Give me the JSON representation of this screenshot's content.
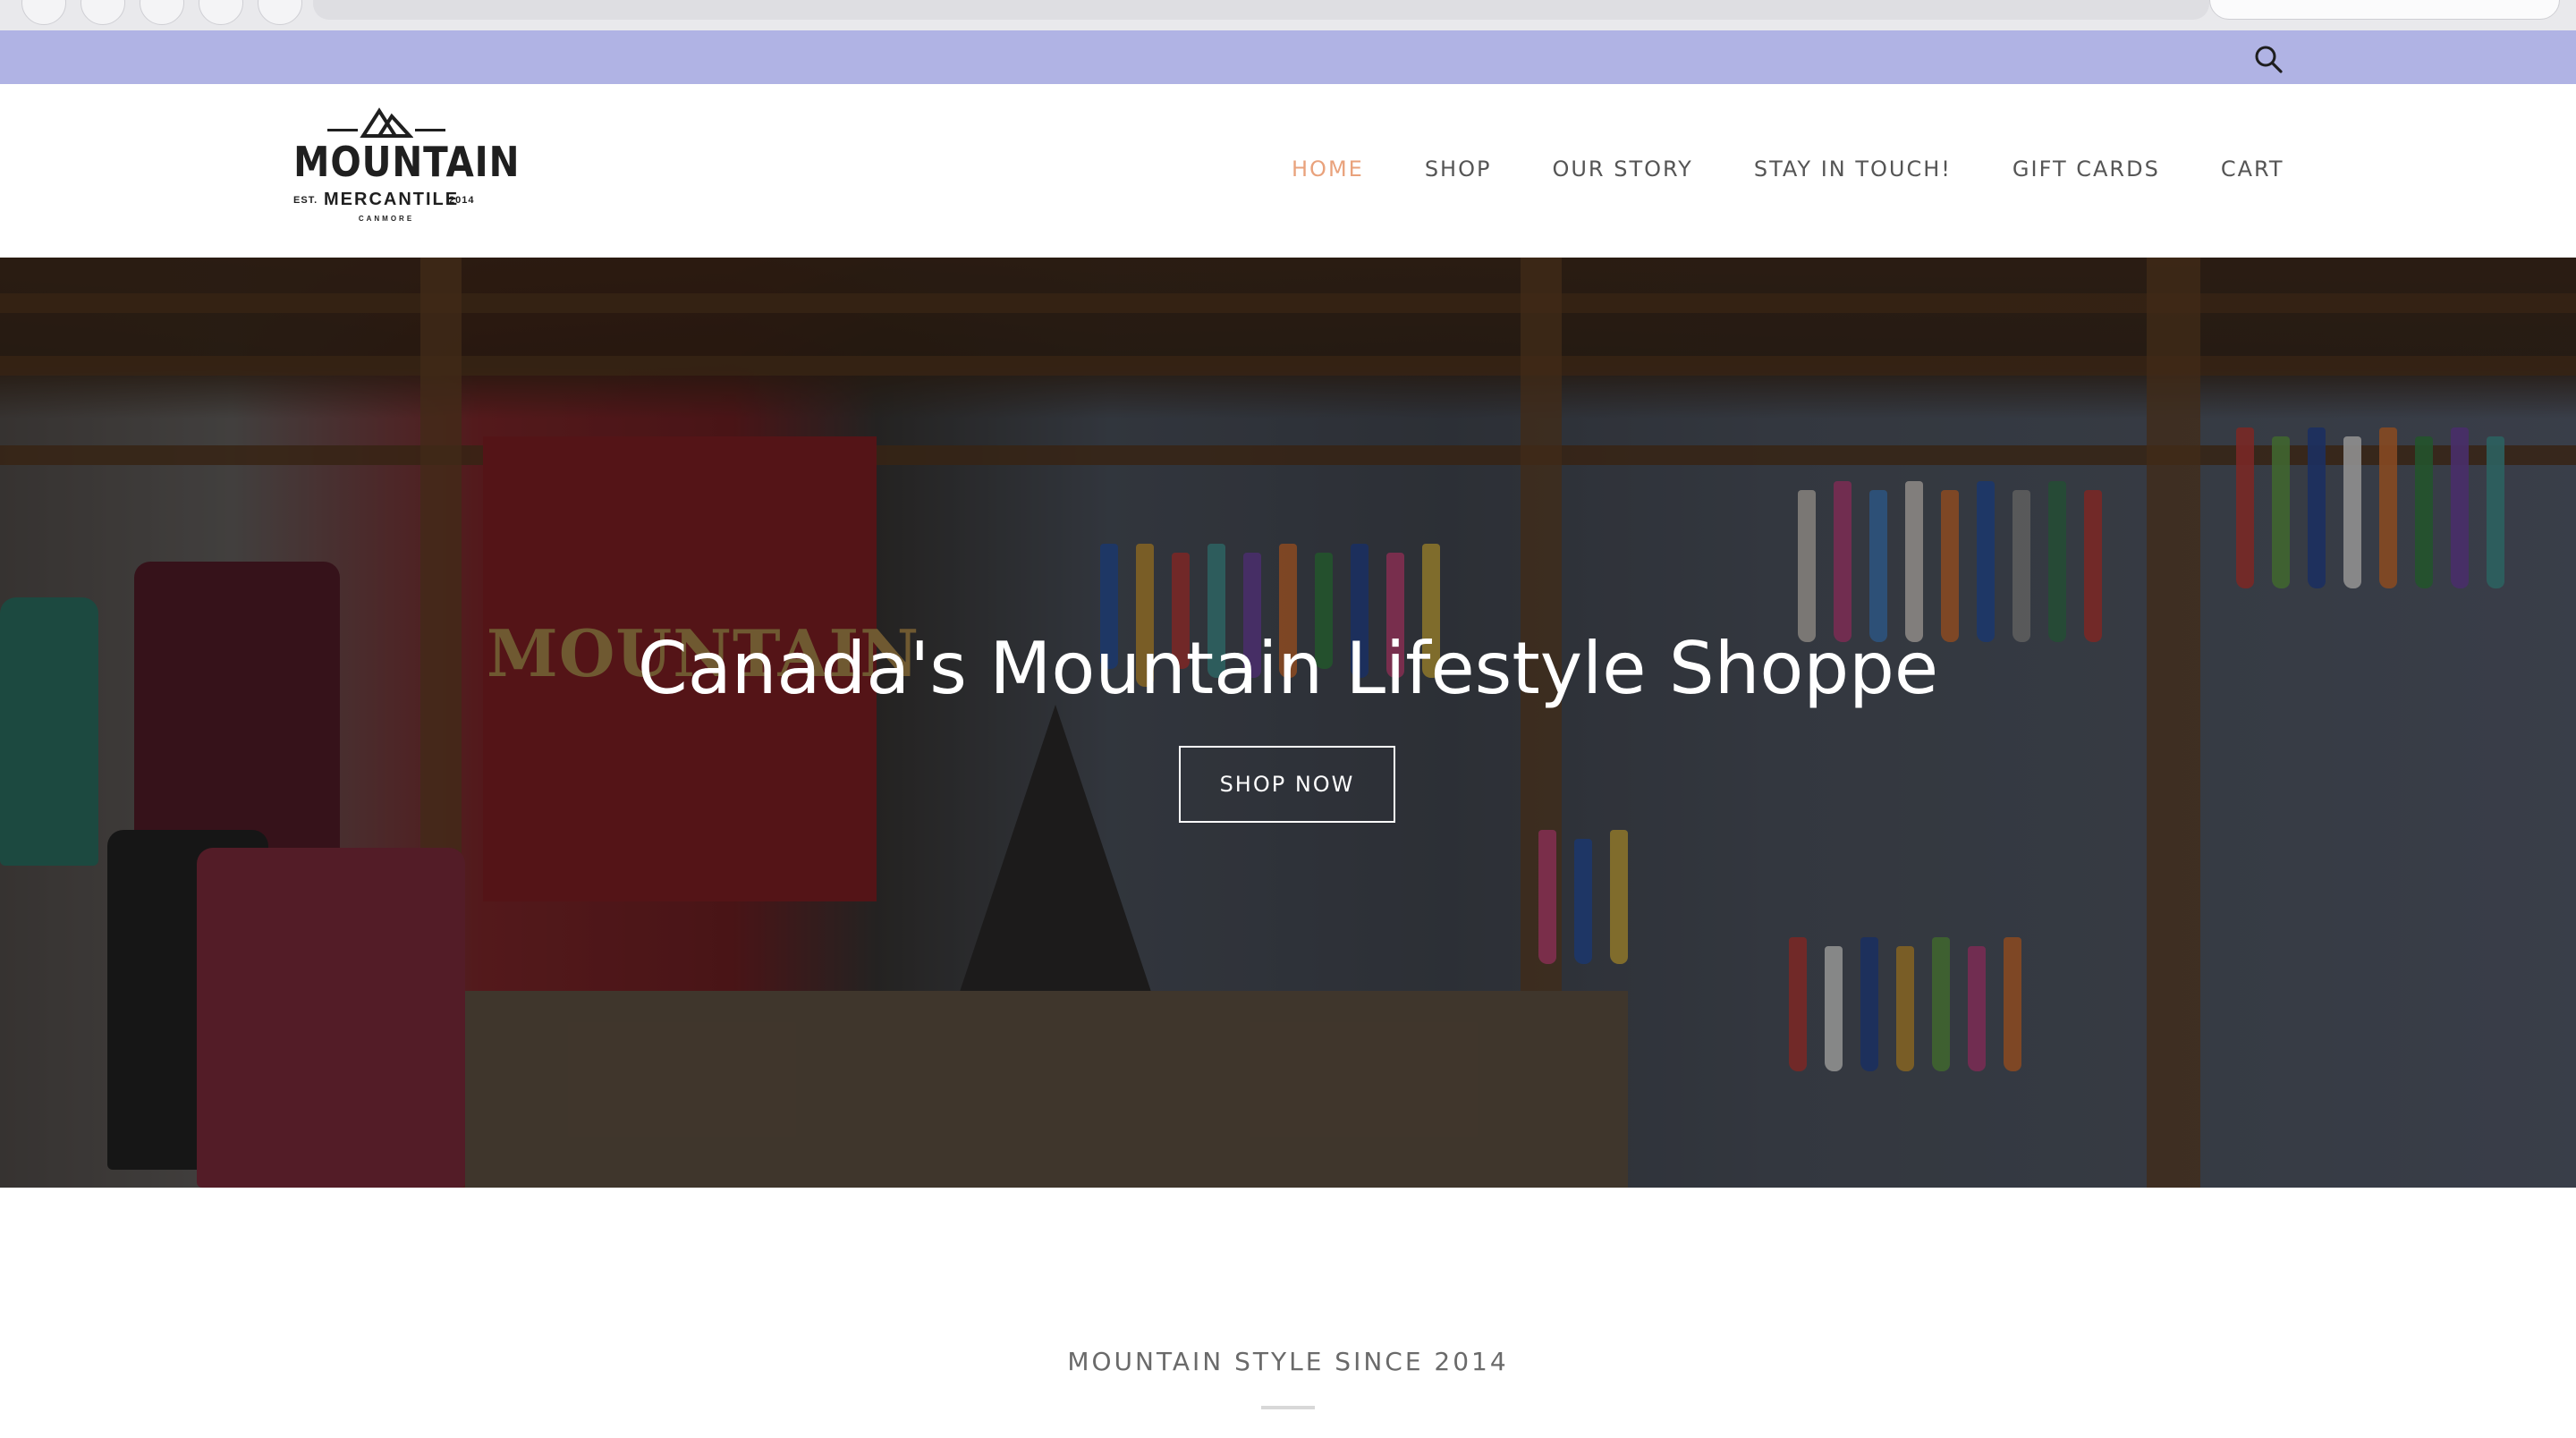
{
  "announcement_bar": {
    "background": "#b0b3e4",
    "search_icon": "search-icon"
  },
  "brand": {
    "logo_word": "MOUNTAIN",
    "logo_sub": "MERCANTILE",
    "logo_est": "EST.",
    "logo_year": "2014",
    "logo_town": "CANMORE"
  },
  "nav": {
    "items": [
      {
        "label": "HOME",
        "active": true
      },
      {
        "label": "SHOP",
        "active": false
      },
      {
        "label": "OUR STORY",
        "active": false
      },
      {
        "label": "STAY IN TOUCH!",
        "active": false
      },
      {
        "label": "GIFT CARDS",
        "active": false
      },
      {
        "label": "CART",
        "active": false
      }
    ],
    "active_color": "#e9a27c",
    "text_color": "#555555"
  },
  "hero": {
    "title": "Canada's Mountain Lifestyle Shoppe",
    "button": "SHOP NOW",
    "wall_sign": "MOUNTAIN"
  },
  "section": {
    "tagline": "MOUNTAIN STYLE SINCE 2014"
  }
}
